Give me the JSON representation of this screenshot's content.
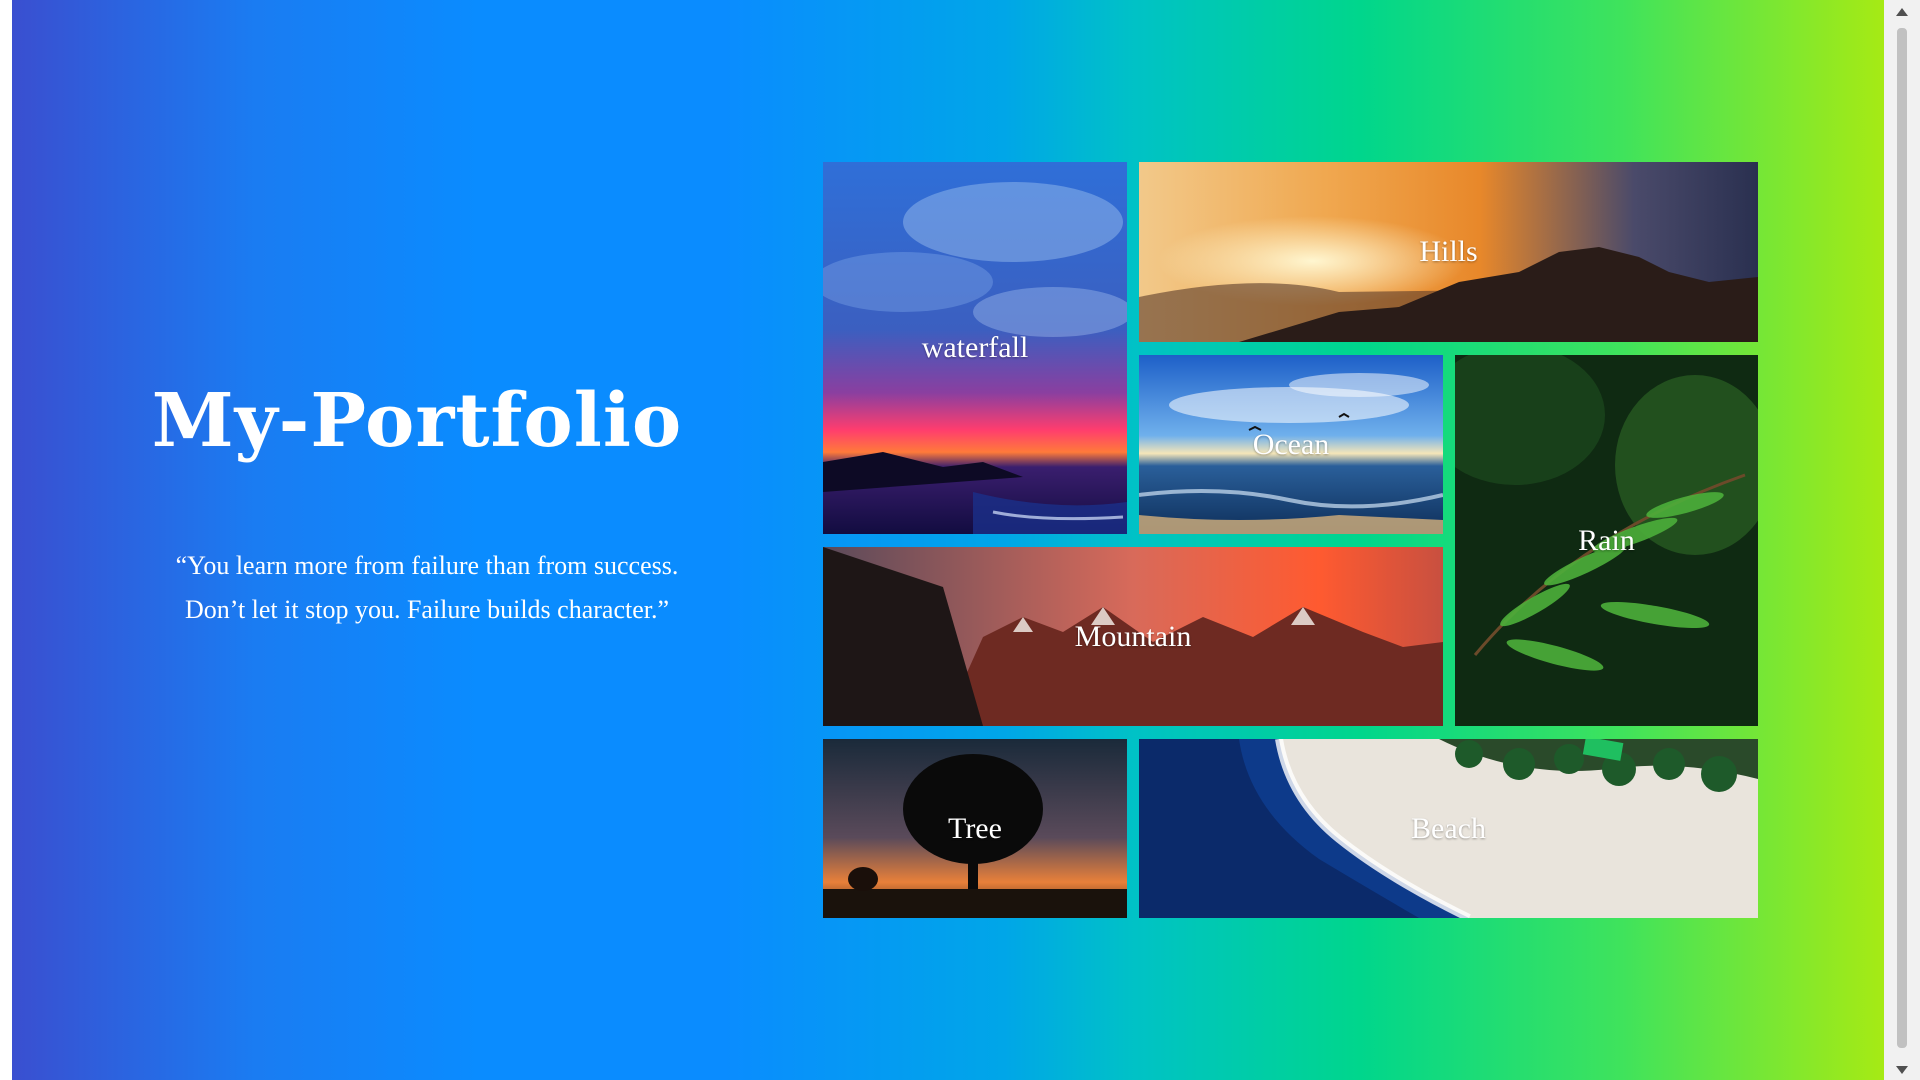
{
  "hero": {
    "title": "My-Portfolio",
    "quote": "“You learn more from failure than from success. Don’t let it stop you. Failure builds character.”"
  },
  "gallery": {
    "tiles": [
      {
        "label": "waterfall"
      },
      {
        "label": "Hills"
      },
      {
        "label": "Ocean"
      },
      {
        "label": "Rain"
      },
      {
        "label": "Mountain"
      },
      {
        "label": "Tree"
      },
      {
        "label": "Beach"
      }
    ]
  },
  "colors": {
    "gradient_start": "#3a4fd0",
    "gradient_mid_blue": "#0a8cff",
    "gradient_mid_green": "#00d68c",
    "gradient_end": "#a6ea14",
    "text": "#ffffff"
  },
  "icons": {
    "scroll_up": "triangle-up",
    "scroll_down": "triangle-down"
  }
}
